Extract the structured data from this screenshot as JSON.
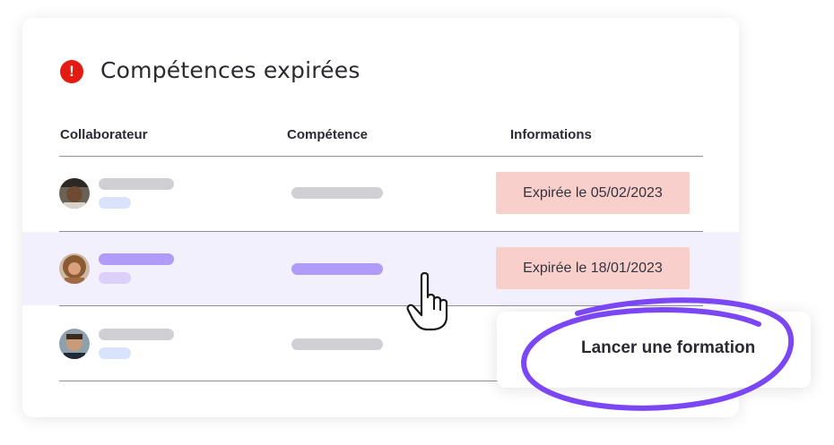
{
  "header": {
    "title": "Compétences expirées",
    "icon": "alert-icon"
  },
  "table": {
    "columns": [
      "Collaborateur",
      "Compétence",
      "Informations"
    ],
    "rows": [
      {
        "info": "Expirée le 05/02/2023",
        "highlighted": false
      },
      {
        "info": "Expirée le 18/01/2023",
        "highlighted": true
      },
      {
        "info": "",
        "highlighted": false
      }
    ]
  },
  "popup": {
    "action_label": "Lancer une formation"
  },
  "colors": {
    "alert": "#e41b13",
    "badge_bg": "#f9cfcc",
    "highlight_bg": "#f3f0fd",
    "accent_purple": "#7b47f4",
    "skeleton_gray": "#d0d0d4"
  }
}
